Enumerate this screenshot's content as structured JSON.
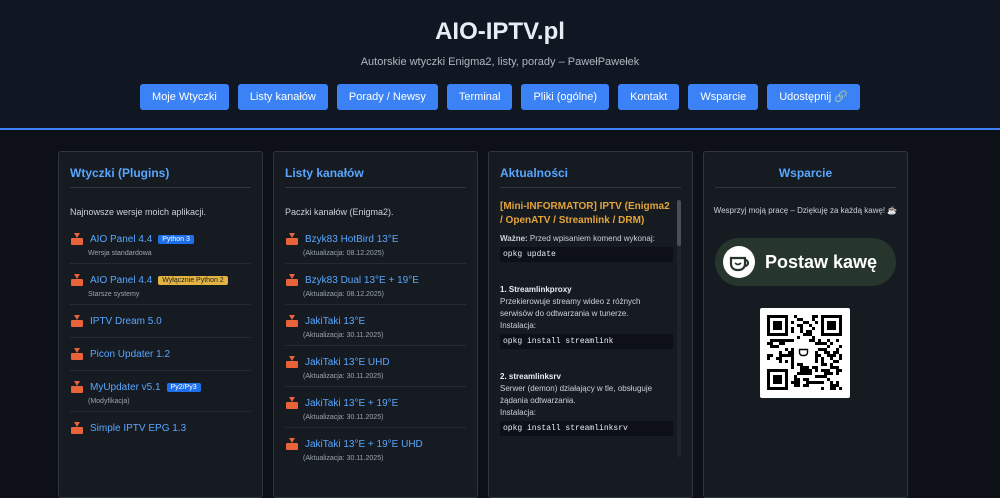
{
  "header": {
    "title": "AIO-IPTV.pl",
    "subtitle": "Autorskie wtyczki Enigma2, listy, porady – PawełPawełek",
    "nav": [
      "Moje Wtyczki",
      "Listy kanałów",
      "Porady / Newsy",
      "Terminal",
      "Pliki (ogólne)",
      "Kontakt",
      "Wsparcie",
      "Udostępnij 🔗"
    ]
  },
  "plugins": {
    "title": "Wtyczki (Plugins)",
    "intro": "Najnowsze wersje moich aplikacji.",
    "items": [
      {
        "name": "AIO Panel 4.4",
        "badge": "Python 3",
        "sub": "Wersja standardowa"
      },
      {
        "name": "AIO Panel 4.4",
        "badge": "Wyłącznie Python 2",
        "sub": "Starsze systemy"
      },
      {
        "name": "IPTV Dream 5.0"
      },
      {
        "name": "Picon Updater 1.2"
      },
      {
        "name": "MyUpdater v5.1",
        "badge": "Py2/Py3",
        "sub": "(Modyfikacja)"
      },
      {
        "name": "Simple IPTV EPG 1.3"
      }
    ]
  },
  "channels": {
    "title": "Listy kanałów",
    "intro": "Paczki kanałów (Enigma2).",
    "items": [
      {
        "name": "Bzyk83 HotBird 13°E",
        "sub": "(Aktualizacja: 08.12.2025)"
      },
      {
        "name": "Bzyk83 Dual 13°E + 19°E",
        "sub": "(Aktualizacja: 08.12.2025)"
      },
      {
        "name": "JakiTaki 13°E",
        "sub": "(Aktualizacja: 30.11.2025)"
      },
      {
        "name": "JakiTaki 13°E UHD",
        "sub": "(Aktualizacja: 30.11.2025)"
      },
      {
        "name": "JakiTaki 13°E + 19°E",
        "sub": "(Aktualizacja: 30.11.2025)"
      },
      {
        "name": "JakiTaki 13°E + 19°E UHD",
        "sub": "(Aktualizacja: 30.11.2025)"
      }
    ]
  },
  "news": {
    "title": "Aktualności",
    "headline": "[Mini-INFORMATOR] IPTV (Enigma2 / OpenATV / Streamlink / DRM)",
    "important_label": "Ważne:",
    "important_text": " Przed wpisaniem komend wykonaj:",
    "cmd_update": "opkg update",
    "s1_title": "1. Streamlinkproxy",
    "s1_text": "Przekierowuje streamy wideo z różnych serwisów do odtwarzania w tunerze.",
    "s1_install": "Instalacja:",
    "s1_cmd": "opkg install streamlink",
    "s2_title": "2. streamlinksrv",
    "s2_text": "Serwer (demon) działający w tle, obsługuje żądania odtwarzania.",
    "s2_install": "Instalacja:",
    "s2_cmd": "opkg install streamlinksrv"
  },
  "support": {
    "title": "Wsparcie",
    "text": "Wesprzyj moją pracę – Dziękuję za każdą kawę! ☕",
    "button_label": "Postaw kawę"
  }
}
